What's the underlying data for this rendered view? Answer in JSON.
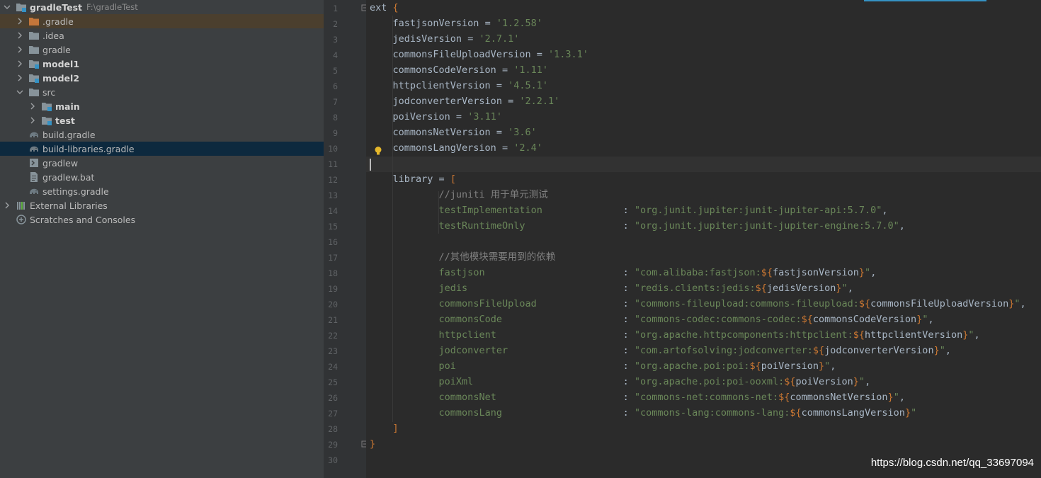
{
  "project": {
    "name": "gradleTest",
    "path": "F:\\gradleTest"
  },
  "tree": [
    {
      "label": ".gradle",
      "depth": 1,
      "chevron": "right",
      "icon": "folder-orange-icon"
    },
    {
      "label": ".idea",
      "depth": 1,
      "chevron": "right",
      "icon": "folder-icon"
    },
    {
      "label": "gradle",
      "depth": 1,
      "chevron": "right",
      "icon": "folder-icon"
    },
    {
      "label": "model1",
      "depth": 1,
      "chevron": "right",
      "icon": "module-folder-icon"
    },
    {
      "label": "model2",
      "depth": 1,
      "chevron": "right",
      "icon": "module-folder-icon"
    },
    {
      "label": "src",
      "depth": 1,
      "chevron": "down",
      "icon": "folder-icon"
    },
    {
      "label": "main",
      "depth": 2,
      "chevron": "right",
      "icon": "module-folder-icon"
    },
    {
      "label": "test",
      "depth": 2,
      "chevron": "right",
      "icon": "module-folder-icon"
    },
    {
      "label": "build.gradle",
      "depth": 1,
      "chevron": "none",
      "icon": "gradle-icon"
    },
    {
      "label": "build-libraries.gradle",
      "depth": 1,
      "chevron": "none",
      "icon": "gradle-icon"
    },
    {
      "label": "gradlew",
      "depth": 1,
      "chevron": "none",
      "icon": "terminal-file-icon"
    },
    {
      "label": "gradlew.bat",
      "depth": 1,
      "chevron": "none",
      "icon": "text-file-icon"
    },
    {
      "label": "settings.gradle",
      "depth": 1,
      "chevron": "none",
      "icon": "gradle-icon"
    },
    {
      "label": "External Libraries",
      "depth": 0,
      "chevron": "right",
      "icon": "libraries-icon"
    },
    {
      "label": "Scratches and Consoles",
      "depth": 0,
      "chevron": "none",
      "icon": "scratches-icon"
    }
  ],
  "line_numbers": [
    "1",
    "2",
    "3",
    "4",
    "5",
    "6",
    "7",
    "8",
    "9",
    "10",
    "11",
    "12",
    "13",
    "14",
    "15",
    "16",
    "17",
    "18",
    "19",
    "20",
    "21",
    "22",
    "23",
    "24",
    "25",
    "26",
    "27",
    "28",
    "29",
    "30"
  ],
  "code": {
    "l1": {
      "kw": "ext ",
      "open": "{"
    },
    "versions": [
      {
        "name": "fastjsonVersion",
        "eq": " = ",
        "val": "'1.2.58'"
      },
      {
        "name": "jedisVersion",
        "eq": " = ",
        "val": "'2.7.1'"
      },
      {
        "name": "commonsFileUploadVersion",
        "eq": " = ",
        "val": "'1.3.1'"
      },
      {
        "name": "commonsCodeVersion",
        "eq": " = ",
        "val": "'1.11'"
      },
      {
        "name": "httpclientVersion",
        "eq": " = ",
        "val": "'4.5.1'"
      },
      {
        "name": "jodconverterVersion",
        "eq": " = ",
        "val": "'2.2.1'"
      },
      {
        "name": "poiVersion",
        "eq": " = ",
        "val": "'3.11'"
      },
      {
        "name": "commonsNetVersion",
        "eq": " = ",
        "val": "'3.6'"
      },
      {
        "name": "commonsLangVersion",
        "eq": " = ",
        "val": "'2.4'"
      }
    ],
    "library_decl": {
      "name": "library",
      "eq": " = ",
      "open": "["
    },
    "comment1": "//juniti 用于单元测试",
    "junit": [
      {
        "name": "testImplementation",
        "colon": ": ",
        "val": "\"org.junit.jupiter:junit-jupiter-api:5.7.0\"",
        "tail": ","
      },
      {
        "name": "testRuntimeOnly",
        "colon": ": ",
        "val": "\"org.junit.jupiter:junit-jupiter-engine:5.7.0\"",
        "tail": ","
      }
    ],
    "comment2": "//其他模块需要用到的依赖",
    "deps": [
      {
        "name": "fastjson",
        "pre": "\"com.alibaba:fastjson:",
        "var": "fastjsonVersion",
        "tail": ","
      },
      {
        "name": "jedis",
        "pre": "\"redis.clients:jedis:",
        "var": "jedisVersion",
        "tail": ","
      },
      {
        "name": "commonsFileUpload",
        "pre": "\"commons-fileupload:commons-fileupload:",
        "var": "commonsFileUploadVersion",
        "tail": ","
      },
      {
        "name": "commonsCode",
        "pre": "\"commons-codec:commons-codec:",
        "var": "commonsCodeVersion",
        "tail": ","
      },
      {
        "name": "httpclient",
        "pre": "\"org.apache.httpcomponents:httpclient:",
        "var": "httpclientVersion",
        "tail": ","
      },
      {
        "name": "jodconverter",
        "pre": "\"com.artofsolving:jodconverter:",
        "var": "jodconverterVersion",
        "tail": ","
      },
      {
        "name": "poi",
        "pre": "\"org.apache.poi:poi:",
        "var": "poiVersion",
        "tail": ","
      },
      {
        "name": "poiXml",
        "pre": "\"org.apache.poi:poi-ooxml:",
        "var": "poiVersion",
        "tail": ","
      },
      {
        "name": "commonsNet",
        "pre": "\"commons-net:commons-net:",
        "var": "commonsNetVersion",
        "tail": ","
      },
      {
        "name": "commonsLang",
        "pre": "\"commons-lang:commons-lang:",
        "var": "commonsLangVersion",
        "tail": ""
      }
    ],
    "close_bracket": "]",
    "close_brace": "}"
  },
  "watermark": "https://blog.csdn.net/qq_33697094",
  "colors": {
    "string": "#6a8759",
    "keyword": "#cc7832",
    "text": "#a9b7c6",
    "comment": "#808080",
    "selection": "#0d293e"
  }
}
